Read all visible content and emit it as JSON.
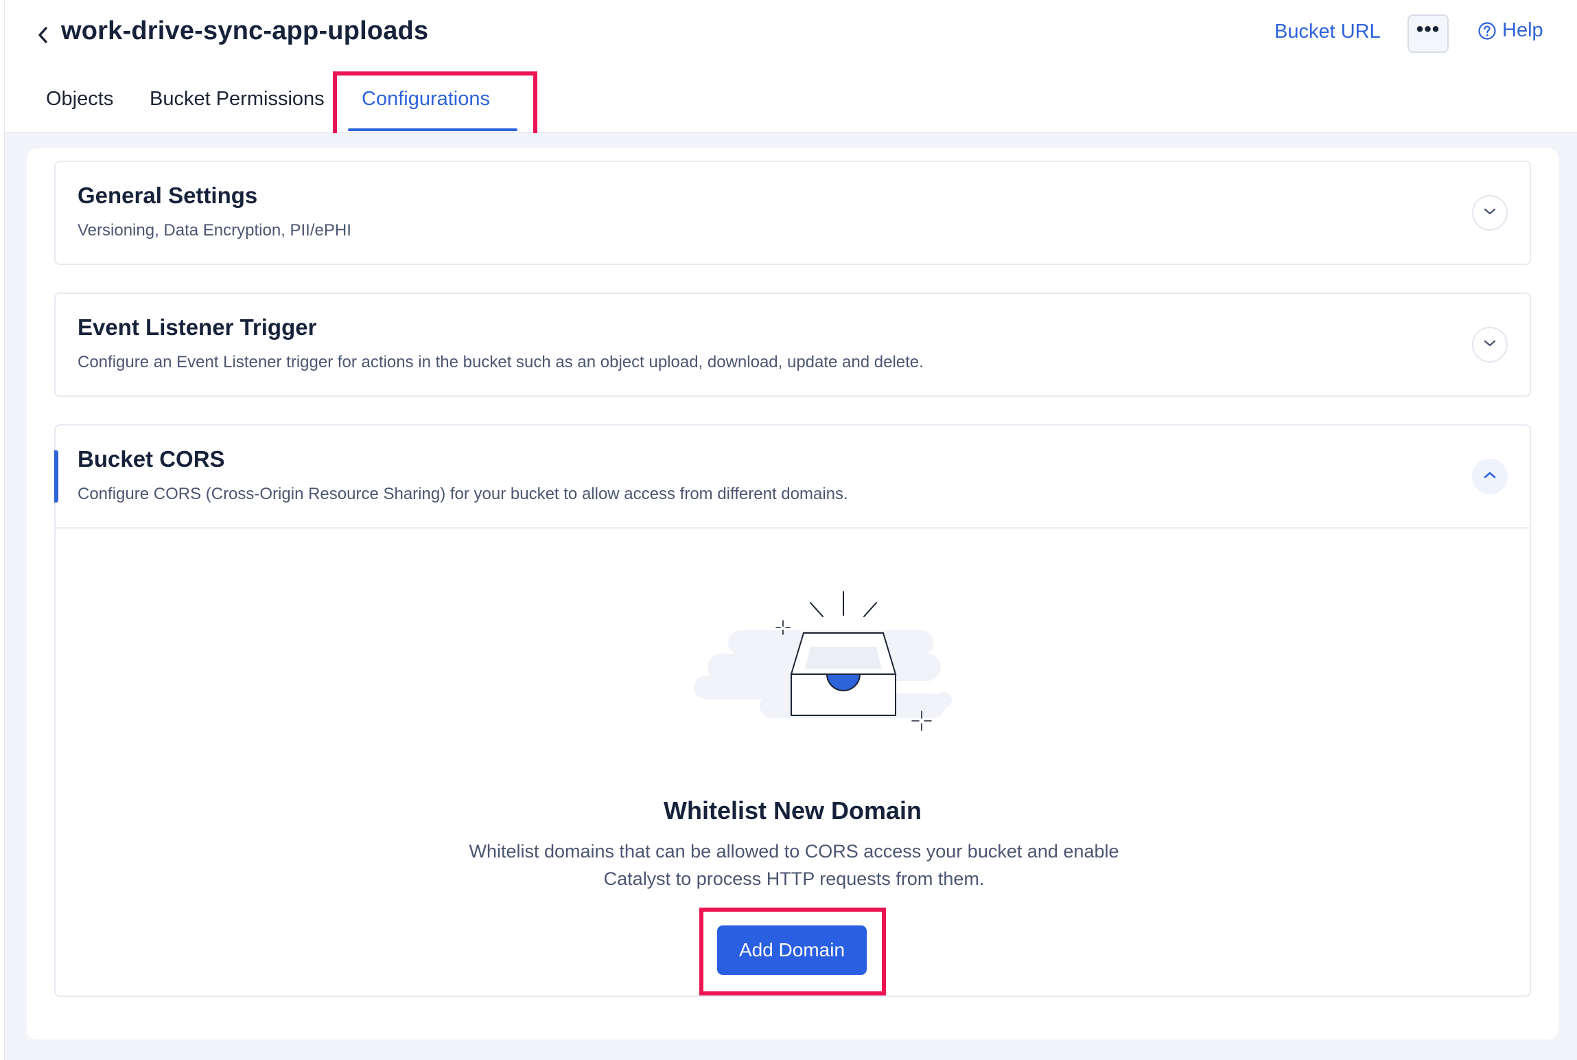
{
  "header": {
    "title": "work-drive-sync-app-uploads",
    "bucket_url_label": "Bucket URL",
    "more_label": "•••",
    "help_label": "Help"
  },
  "tabs": [
    {
      "label": "Objects",
      "active": false
    },
    {
      "label": "Bucket Permissions",
      "active": false
    },
    {
      "label": "Configurations",
      "active": true
    }
  ],
  "sections": {
    "general": {
      "title": "General Settings",
      "description": "Versioning, Data Encryption, PII/ePHI",
      "expanded": false
    },
    "event_listener": {
      "title": "Event Listener Trigger",
      "description": "Configure an Event Listener trigger for actions in the bucket such as an object upload, download, update and delete.",
      "expanded": false
    },
    "cors": {
      "title": "Bucket CORS",
      "description": "Configure CORS (Cross-Origin Resource Sharing) for your bucket to allow access from different domains.",
      "expanded": true,
      "empty_state": {
        "illustration": "empty-inbox-tray-illustration",
        "title": "Whitelist New Domain",
        "description": "Whitelist domains that can be allowed to CORS access your bucket and enable Catalyst to process HTTP requests from them.",
        "button_label": "Add Domain"
      }
    }
  },
  "colors": {
    "accent": "#2e63d9",
    "primary_button": "#2a5fe2",
    "highlight": "#ec1553",
    "background": "#f2f4f9"
  },
  "icons": {
    "back": "chevron-left-icon",
    "help": "question-circle-icon",
    "more": "ellipsis-icon",
    "collapsed": "chevron-down-icon",
    "expanded": "chevron-up-icon"
  }
}
